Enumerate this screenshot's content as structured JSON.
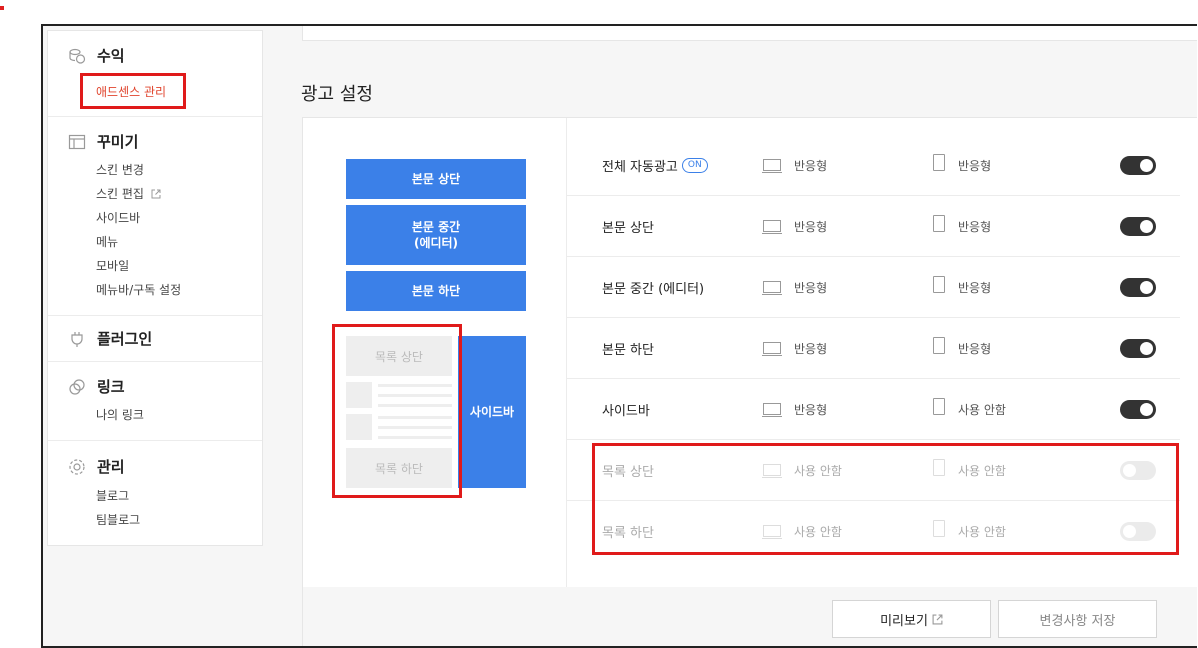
{
  "sidebar": {
    "revenue": {
      "title": "수익",
      "items": [
        {
          "label": "애드센스 관리"
        }
      ]
    },
    "decorate": {
      "title": "꾸미기",
      "items": [
        {
          "label": "스킨 변경"
        },
        {
          "label": "스킨 편집"
        },
        {
          "label": "사이드바"
        },
        {
          "label": "메뉴"
        },
        {
          "label": "모바일"
        },
        {
          "label": "메뉴바/구독 설정"
        }
      ]
    },
    "plugin": {
      "title": "플러그인"
    },
    "link": {
      "title": "링크",
      "items": [
        {
          "label": "나의 링크"
        }
      ]
    },
    "manage": {
      "title": "관리",
      "items": [
        {
          "label": "블로그"
        },
        {
          "label": "팀블로그"
        }
      ]
    }
  },
  "page": {
    "title": "광고 설정"
  },
  "preview": {
    "top": "본문 상단",
    "middle_line1": "본문 중간",
    "middle_line2": "(에디터)",
    "bottom": "본문 하단",
    "list_top": "목록 상단",
    "list_bottom": "목록 하단",
    "sidebar": "사이드바"
  },
  "on_badge": "ON",
  "rows": [
    {
      "label": "전체 자동광고",
      "pc": "반응형",
      "mobile": "반응형",
      "enabled": true
    },
    {
      "label": "본문 상단",
      "pc": "반응형",
      "mobile": "반응형",
      "enabled": true
    },
    {
      "label": "본문 중간 (에디터)",
      "pc": "반응형",
      "mobile": "반응형",
      "enabled": true
    },
    {
      "label": "본문 하단",
      "pc": "반응형",
      "mobile": "반응형",
      "enabled": true
    },
    {
      "label": "사이드바",
      "pc": "반응형",
      "mobile": "사용 안함",
      "enabled": true
    },
    {
      "label": "목록 상단",
      "pc": "사용 안함",
      "mobile": "사용 안함",
      "enabled": false
    },
    {
      "label": "목록 하단",
      "pc": "사용 안함",
      "mobile": "사용 안함",
      "enabled": false
    }
  ],
  "buttons": {
    "preview": "미리보기",
    "save": "변경사항 저장"
  },
  "colors": {
    "accent": "#3b80e8",
    "highlight": "#e01a1a"
  }
}
